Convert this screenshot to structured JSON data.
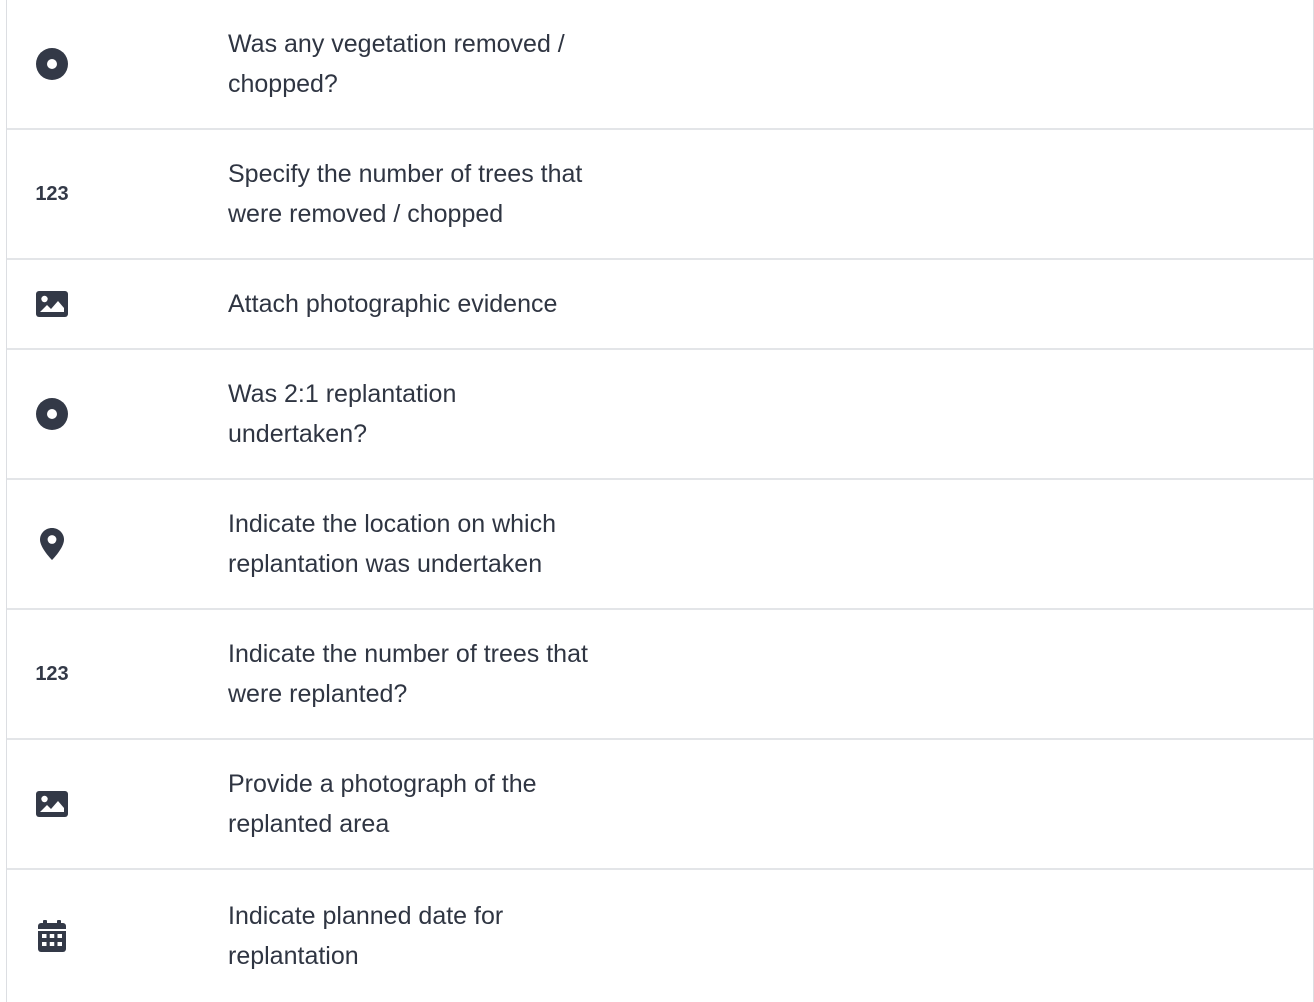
{
  "questions": [
    {
      "icon": "radio-icon",
      "label": "Was any vegetation removed / chopped?"
    },
    {
      "icon": "number-icon",
      "icon_text": "123",
      "label": "Specify the number of trees that were removed / chopped"
    },
    {
      "icon": "image-icon",
      "label": "Attach photographic evidence"
    },
    {
      "icon": "radio-icon",
      "label": "Was 2:1 replantation undertaken?"
    },
    {
      "icon": "location-pin-icon",
      "label": "Indicate the location on which replantation was undertaken"
    },
    {
      "icon": "number-icon",
      "icon_text": "123",
      "label": "Indicate the number of trees that were replanted?"
    },
    {
      "icon": "image-icon",
      "label": "Provide a photograph of the replanted area"
    },
    {
      "icon": "calendar-icon",
      "label": "Indicate planned date for replantation"
    }
  ]
}
